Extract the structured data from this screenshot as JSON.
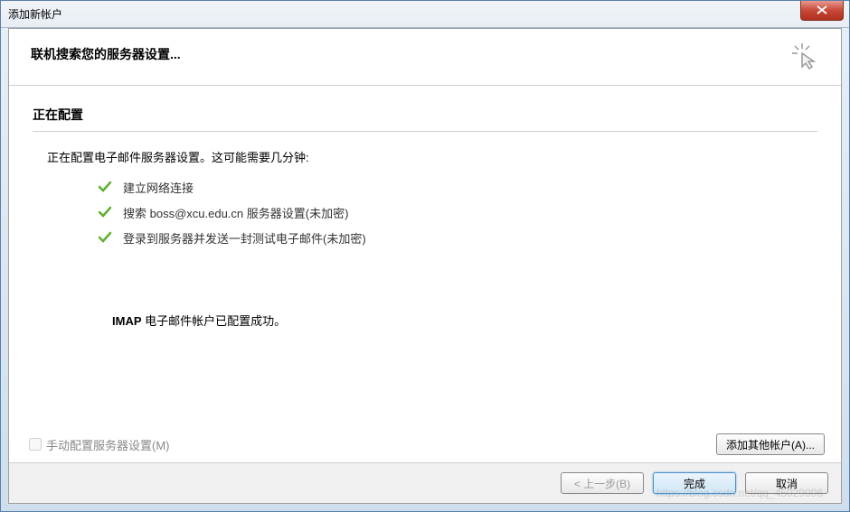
{
  "window": {
    "title": "添加新帐户"
  },
  "header": {
    "title": "联机搜索您的服务器设置..."
  },
  "content": {
    "section_heading": "正在配置",
    "intro_text": "正在配置电子邮件服务器设置。这可能需要几分钟:",
    "steps": [
      {
        "text": "建立网络连接"
      },
      {
        "text": "搜索 boss@xcu.edu.cn 服务器设置(未加密)"
      },
      {
        "text": "登录到服务器并发送一封测试电子邮件(未加密)"
      }
    ],
    "success_prefix": "IMAP",
    "success_text": " 电子邮件帐户已配置成功。"
  },
  "options": {
    "manual_config_label": "手动配置服务器设置(M)",
    "add_account_label": "添加其他帐户(A)..."
  },
  "buttons": {
    "back": "< 上一步(B)",
    "finish": "完成",
    "cancel": "取消"
  },
  "watermark": "https://blog.csdn.net/qq_45029006"
}
